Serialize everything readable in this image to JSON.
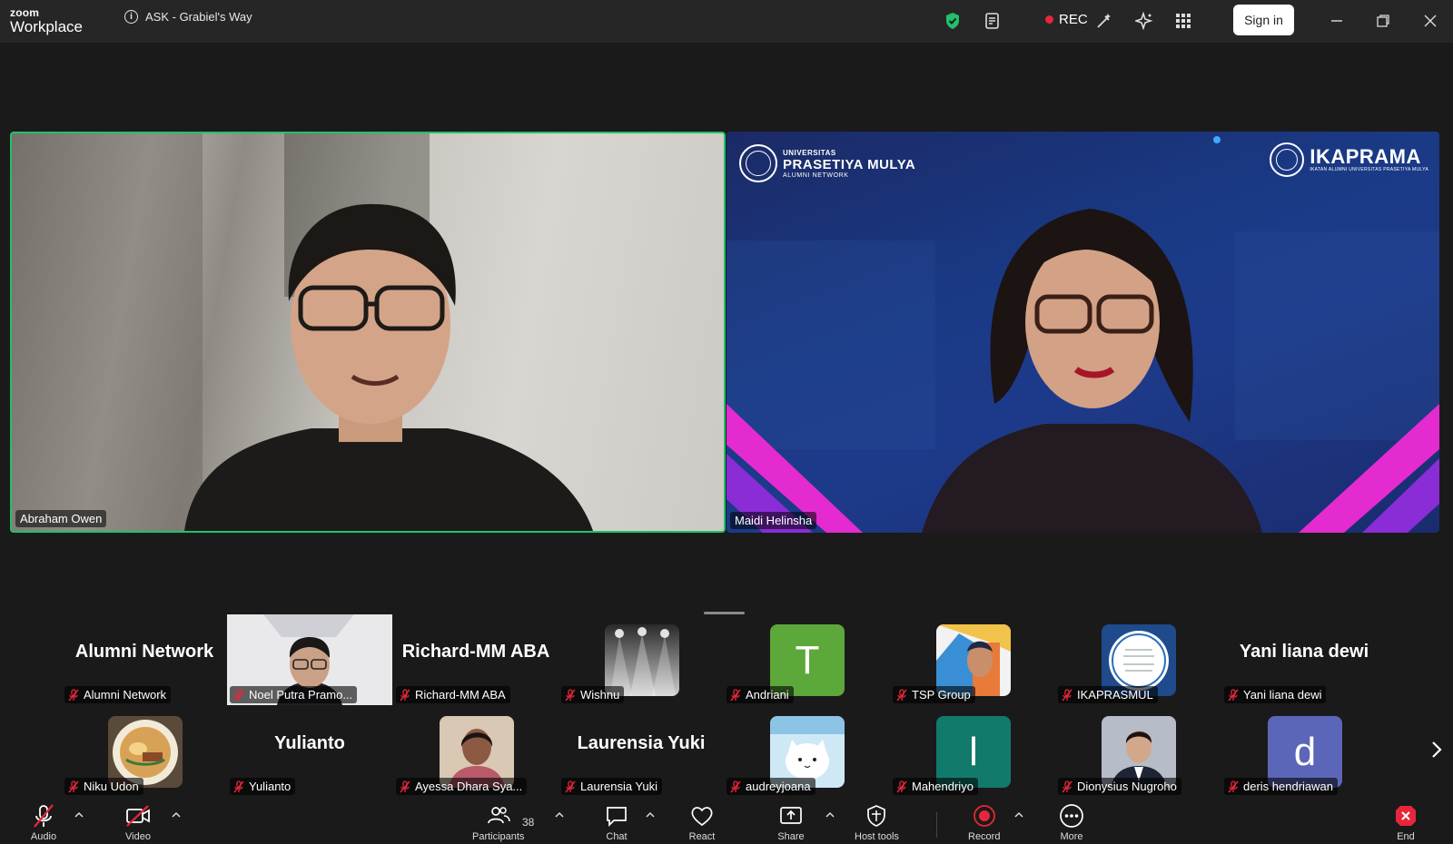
{
  "app": {
    "brand_top": "zoom",
    "brand_bottom": "Workplace"
  },
  "meeting": {
    "title": "ASK - Grabiel's Way"
  },
  "titlebar": {
    "rec_label": "REC",
    "signin_label": "Sign in"
  },
  "speakers": [
    {
      "name": "Abraham Owen"
    },
    {
      "name": "Maidi Helinsha"
    }
  ],
  "slide": {
    "left_logo_line1": "UNIVERSITAS",
    "left_logo_line2": "PRASETIYA MULYA",
    "left_logo_line3": "ALUMNI NETWORK",
    "right_logo_big": "IKAPRAMA",
    "right_logo_small": "IKATAN ALUMNI UNIVERSITAS PRASETIYA MULYA"
  },
  "gallery": {
    "row1": [
      {
        "big": "Alumni Network",
        "label": "Alumni Network",
        "type": "name"
      },
      {
        "big": "",
        "label": "Noel Putra Pramo...",
        "type": "camera"
      },
      {
        "big": "Richard-MM ABA",
        "label": "Richard-MM ABA",
        "type": "name"
      },
      {
        "big": "",
        "label": "Wishnu",
        "type": "image",
        "color": "#3a3a3a"
      },
      {
        "big": "T",
        "label": "Andriani",
        "type": "letter",
        "color": "#5ca83a"
      },
      {
        "big": "",
        "label": "TSP Group",
        "type": "image",
        "color": "#e5a53a"
      },
      {
        "big": "",
        "label": "IKAPRASMUL",
        "type": "image",
        "color": "#1f4a8c"
      },
      {
        "big": "Yani liana dewi",
        "label": "Yani liana dewi",
        "type": "name"
      }
    ],
    "row2": [
      {
        "big": "",
        "label": "Niku Udon",
        "type": "image",
        "color": "#b58b5a"
      },
      {
        "big": "Yulianto",
        "label": "Yulianto",
        "type": "name"
      },
      {
        "big": "",
        "label": "Ayessa Dhara Sya...",
        "type": "image",
        "color": "#8a6a55"
      },
      {
        "big": "Laurensia  Yuki",
        "label": "Laurensia  Yuki",
        "type": "name"
      },
      {
        "big": "",
        "label": "audreyjoana",
        "type": "image",
        "color": "#a8d4ee"
      },
      {
        "big": "l",
        "label": "Mahendriyo",
        "type": "letter",
        "color": "#127a6b"
      },
      {
        "big": "",
        "label": "Dionysius Nugroho",
        "type": "image",
        "color": "#9aa4b4"
      },
      {
        "big": "d",
        "label": "deris hendriawan",
        "type": "letter",
        "color": "#5c66b8"
      }
    ]
  },
  "toolbar": {
    "audio": "Audio",
    "video": "Video",
    "participants": "Participants",
    "participants_count": "38",
    "chat": "Chat",
    "react": "React",
    "share": "Share",
    "host_tools": "Host tools",
    "record": "Record",
    "more": "More",
    "end": "End"
  },
  "colors": {
    "active_speaker_border": "#21c16b",
    "rec": "#e8263b",
    "mute": "#e8263b"
  }
}
